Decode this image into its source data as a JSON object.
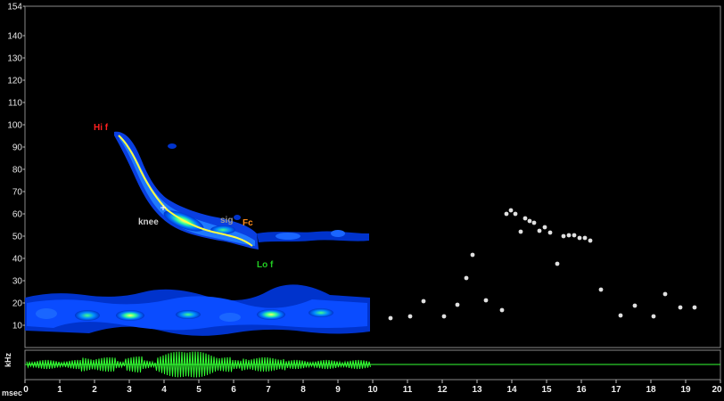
{
  "spectrogram": {
    "y_axis": {
      "top_label": "154",
      "ticks": [
        "140",
        "130",
        "120",
        "110",
        "100",
        "90",
        "80",
        "70",
        "60",
        "50",
        "40",
        "30",
        "20",
        "10"
      ],
      "unit": "kHz"
    },
    "x_axis": {
      "ticks": [
        "0",
        "1",
        "2",
        "3",
        "4",
        "5",
        "6",
        "7",
        "8",
        "9",
        "10",
        "11",
        "12",
        "13",
        "14",
        "15",
        "16",
        "17",
        "18",
        "19",
        "20"
      ],
      "unit": "msec"
    },
    "markers": {
      "hif": {
        "label": "Hi f",
        "color": "#ff2020"
      },
      "knee": {
        "label": "knee",
        "color": "#cfcfcf"
      },
      "sig": {
        "label": "sig",
        "color": "#9a9a9a"
      },
      "fc": {
        "label": "Fc",
        "color": "#ff8c1a"
      },
      "lof": {
        "label": "Lo f",
        "color": "#22cc22"
      }
    },
    "colors": {
      "background": "#000000",
      "axis": "#c0c0c0",
      "call_trace": "#ffff40",
      "waveform": "#33ff33",
      "dots": "#e0e0e0"
    }
  }
}
